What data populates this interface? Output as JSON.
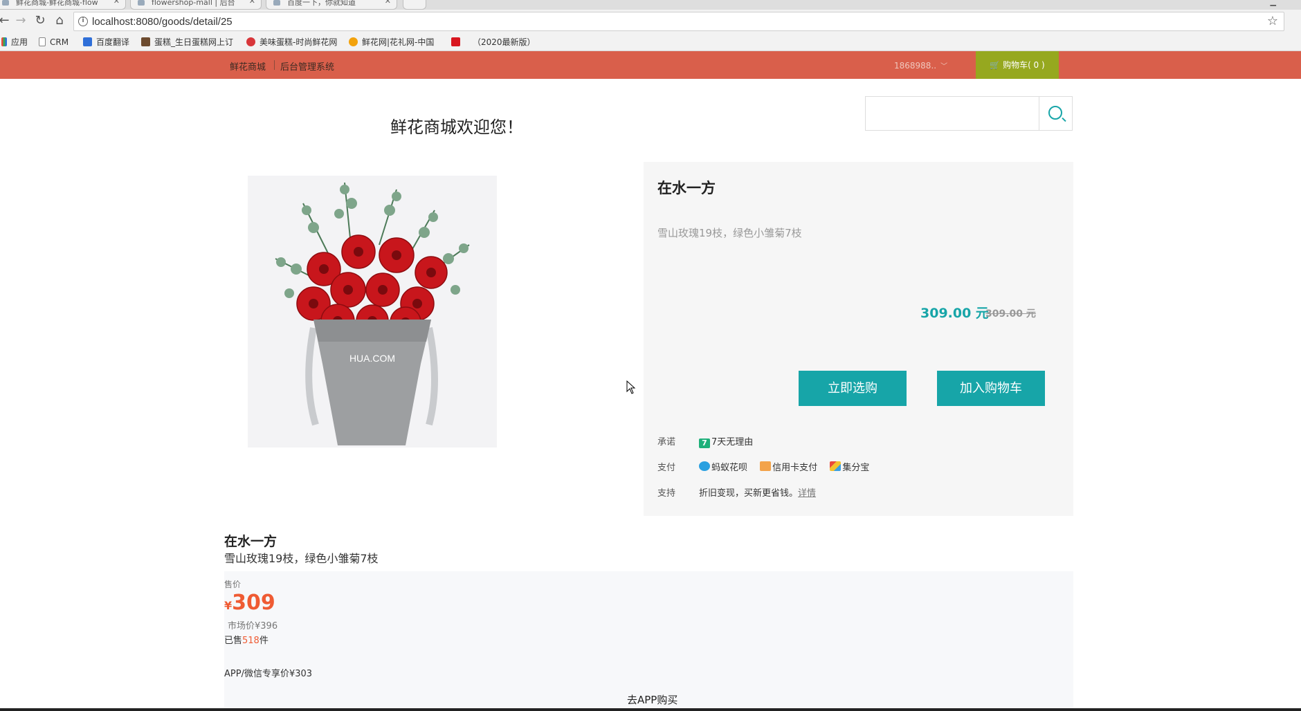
{
  "browser": {
    "tabs": [
      {
        "label": "鲜花商城-鲜花商城-flow"
      },
      {
        "label": "flowershop-mall | 后台"
      },
      {
        "label": "百度一下，你就知道"
      }
    ],
    "url": "localhost:8080/goods/detail/25",
    "bookmarks": [
      {
        "label": "应用",
        "color": "#e94a3b"
      },
      {
        "label": "CRM",
        "color": "#ffffff"
      },
      {
        "label": "百度翻译",
        "color": "#2f6fd8"
      },
      {
        "label": "蛋糕_生日蛋糕网上订",
        "color": "#6d4b2f"
      },
      {
        "label": "美味蛋糕-时尚鲜花网",
        "color": "#d8363a"
      },
      {
        "label": "鲜花网|花礼网-中国",
        "color": "#f2a20c"
      },
      {
        "label": "（2020最新版）",
        "color": "#d8161f"
      }
    ]
  },
  "header": {
    "brand": "鲜花商城",
    "admin": "后台管理系统",
    "user": "1868988..",
    "cart_label": "购物车( 0 )"
  },
  "welcome": "鲜花商城欢迎您！",
  "search": {
    "placeholder": ""
  },
  "product": {
    "image_text": "HUA.COM",
    "title": "在水一方",
    "desc": "雪山玫瑰19枝，绿色小雏菊7枝",
    "price": "309.00 元",
    "old_price": "309.00 元",
    "buy_label": "立即选购",
    "add_label": "加入购物车",
    "promise_label": "承诺",
    "promise_value": "7天无理由",
    "promise_badge": "7",
    "pay_label": "支付",
    "pay_methods": [
      "蚂蚁花呗",
      "信用卡支付",
      "集分宝"
    ],
    "support_label": "支持",
    "support_value": "折旧变现，买新更省钱。",
    "support_link": "详情"
  },
  "detail": {
    "title": "在水一方",
    "desc": "雪山玫瑰19枝，绿色小雏菊7枝",
    "price_label": "售价",
    "currency": "¥",
    "price": "309",
    "market_price": "市场价¥396",
    "sold_prefix": "已售",
    "sold_count": "518",
    "sold_suffix": "件",
    "app_price": "APP/微信专享价¥303",
    "go_app": "去APP购买"
  },
  "colors": {
    "header_bg": "#d95f4b",
    "cart_bg": "#96a81f",
    "accent": "#17a5a8",
    "price_orange": "#ef5b33"
  }
}
